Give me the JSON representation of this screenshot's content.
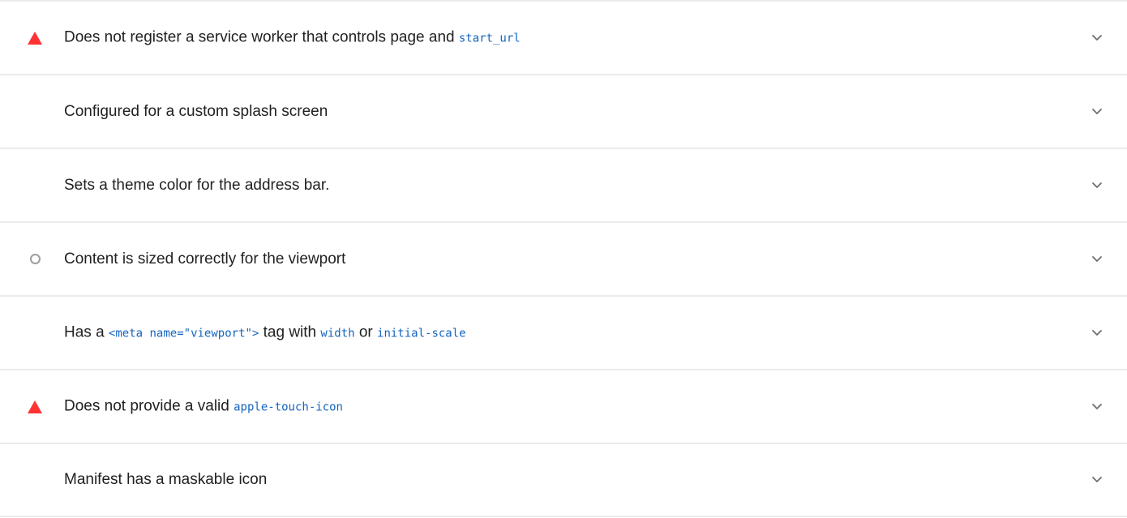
{
  "audits": [
    {
      "status": "fail",
      "parts": [
        {
          "text": "Does not register a service worker that controls page and ",
          "code": false
        },
        {
          "text": "start_url",
          "code": true
        }
      ]
    },
    {
      "status": "none",
      "parts": [
        {
          "text": "Configured for a custom splash screen",
          "code": false
        }
      ]
    },
    {
      "status": "none",
      "parts": [
        {
          "text": "Sets a theme color for the address bar.",
          "code": false
        }
      ]
    },
    {
      "status": "neutral",
      "parts": [
        {
          "text": "Content is sized correctly for the viewport",
          "code": false
        }
      ]
    },
    {
      "status": "none",
      "parts": [
        {
          "text": "Has a ",
          "code": false
        },
        {
          "text": "<meta name=\"viewport\">",
          "code": true
        },
        {
          "text": " tag with ",
          "code": false
        },
        {
          "text": "width",
          "code": true
        },
        {
          "text": " or ",
          "code": false
        },
        {
          "text": "initial-scale",
          "code": true
        }
      ]
    },
    {
      "status": "fail",
      "parts": [
        {
          "text": "Does not provide a valid ",
          "code": false
        },
        {
          "text": "apple-touch-icon",
          "code": true
        }
      ]
    },
    {
      "status": "none",
      "parts": [
        {
          "text": "Manifest has a maskable icon",
          "code": false
        }
      ]
    }
  ],
  "colors": {
    "fail": "#ff3333",
    "neutral": "#9e9e9e",
    "code": "#1565c0",
    "divider": "#ebebeb"
  },
  "icons": {
    "fail": "warning-triangle-icon",
    "neutral": "empty-circle-icon",
    "expand": "chevron-down-icon"
  }
}
